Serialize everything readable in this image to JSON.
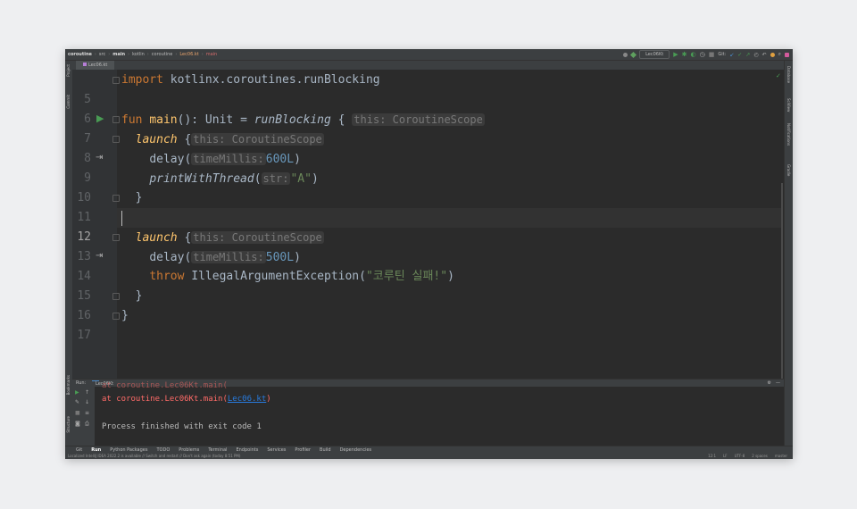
{
  "breadcrumb": [
    "coroutine",
    "src",
    "main",
    "kotlin",
    "coroutine",
    "Lec06.kt",
    "main"
  ],
  "toolbar": {
    "run_config": "Lec06Kt",
    "git_label": "Git:"
  },
  "editor_tab": "Lec06.kt",
  "left_tools": [
    "Project",
    "Commit",
    "Bookmarks",
    "Structure"
  ],
  "right_tools": [
    "Database",
    "SciView",
    "Notifications",
    "Gradle"
  ],
  "code": {
    "line_numbers": [
      "5",
      "6",
      "7",
      "8",
      "9",
      "10",
      "11",
      "12",
      "13",
      "14",
      "15",
      "16",
      "17"
    ],
    "l5": {
      "kw": "import",
      "rest": " kotlinx.coroutines.runBlocking"
    },
    "l7": {
      "kw": "fun",
      "sp": " ",
      "fn": "main",
      "mid": "(): Unit = ",
      "call": "runBlocking",
      "brace": " {",
      "hint": "this: CoroutineScope"
    },
    "l8": {
      "call": "launch",
      "brace": " {",
      "hint": "this: CoroutineScope"
    },
    "l9": {
      "name": "delay(",
      "hint": "timeMillis:",
      "num": "600L",
      "close": ")"
    },
    "l10": {
      "call": "printWithThread",
      "open": "(",
      "hint": "str:",
      "str": "\"A\"",
      "close": ")"
    },
    "l11": "}",
    "l13": {
      "call": "launch",
      "brace": " {",
      "hint": "this: CoroutineScope"
    },
    "l14": {
      "name": "delay(",
      "hint": "timeMillis:",
      "num": "500L",
      "close": ")"
    },
    "l15": {
      "kw": "throw",
      "mid": " IllegalArgumentException(",
      "str": "\"코루틴 실패!\"",
      "close": ")"
    },
    "l16": "}",
    "l17": "}"
  },
  "run_panel": {
    "label": "Run:",
    "tab": "Lec06Kt",
    "out_at": "at coroutine.Lec06Kt.main(",
    "out_link": "Lec06.kt",
    "out_close": ")",
    "process_done": "Process finished with exit code 1"
  },
  "tool_windows": [
    "Git",
    "Run",
    "Python Packages",
    "TODO",
    "Problems",
    "Terminal",
    "Endpoints",
    "Services",
    "Profiler",
    "Build",
    "Dependencies"
  ],
  "status_bar": {
    "message": "Localized IntelliJ IDEA 2022.2 is available // Switch and restart // Don't ask again (today 8:51 PM)",
    "position": "12:1",
    "line_sep": "LF",
    "encoding": "UTF-8",
    "indent": "2 spaces",
    "branch": "master"
  },
  "colors": {
    "keyword": "#cc7832",
    "function": "#ffc66d",
    "number": "#6897bb",
    "string": "#6a8759",
    "error": "#ff6b68",
    "run_green": "#499c54"
  }
}
